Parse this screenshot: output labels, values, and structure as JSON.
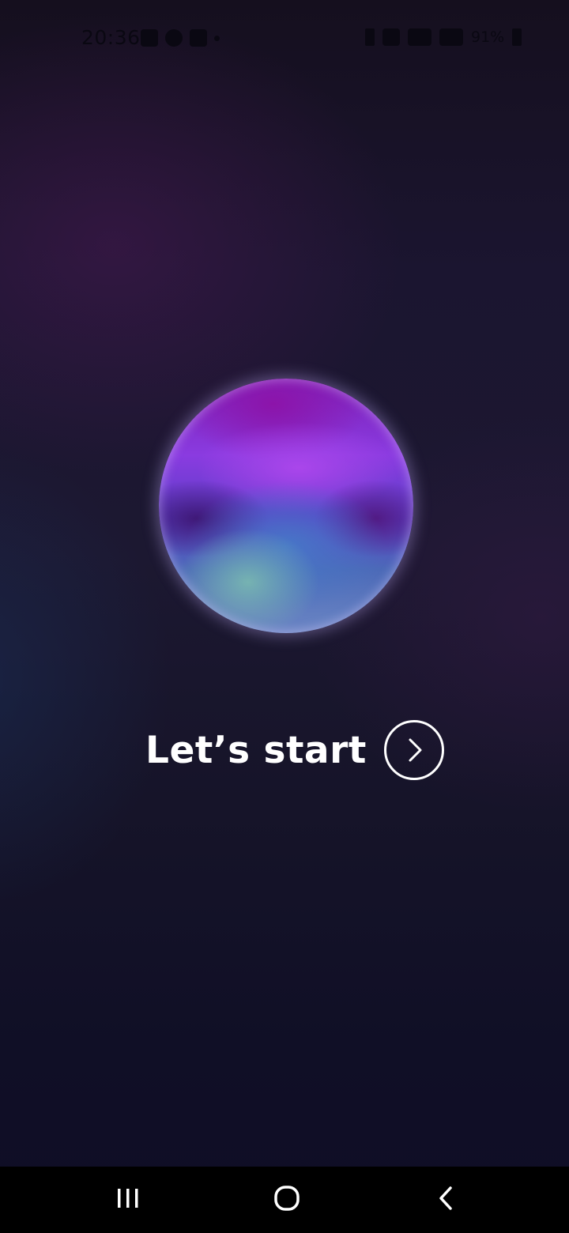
{
  "status_bar": {
    "time": "20:36",
    "battery": "91%"
  },
  "main": {
    "cta_label": "Let’s start"
  },
  "icons": {
    "cta": "chevron-right-icon",
    "recents": "recent-apps-icon",
    "home": "home-icon",
    "back": "back-icon"
  },
  "colors": {
    "background_top": "#150f1e",
    "background_bottom": "#0f0d26",
    "orb_purple": "#8a3be0",
    "orb_blue": "#4c6ab8",
    "orb_teal": "#7dbeaf",
    "text": "#ffffff",
    "nav_bar": "#000000"
  }
}
